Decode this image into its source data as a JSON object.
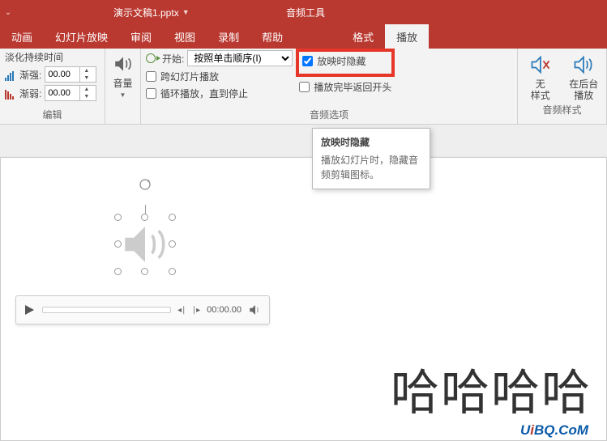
{
  "titlebar": {
    "doc_title": "演示文稿1.pptx",
    "contextual": "音频工具"
  },
  "tabs": {
    "animation": "动画",
    "slideshow": "幻灯片放映",
    "review": "审阅",
    "view": "视图",
    "record": "录制",
    "help": "帮助",
    "format": "格式",
    "playback": "播放"
  },
  "ribbon": {
    "fade": {
      "title": "淡化持续时间",
      "in_label": "渐强:",
      "in_value": "00.00",
      "out_label": "渐弱:",
      "out_value": "00.00",
      "group": "编辑"
    },
    "volume": {
      "label": "音量"
    },
    "options": {
      "start_label": "开始:",
      "start_value": "按照单击顺序(I)",
      "across": "跨幻灯片播放",
      "loop": "循环播放，直到停止",
      "hide": "放映时隐藏",
      "rewind": "播放完毕返回开头",
      "group": "音频选项"
    },
    "style": {
      "none": "无样式",
      "background": "在后台播放",
      "group": "音频样式"
    }
  },
  "tooltip": {
    "title": "放映时隐藏",
    "body": "播放幻灯片时，隐藏音频剪辑图标。"
  },
  "player": {
    "time": "00:00.00"
  },
  "slide": {
    "text": "哈哈哈哈"
  },
  "watermark": {
    "u": "U",
    "i": "i",
    "rest": "BQ.CoM"
  }
}
